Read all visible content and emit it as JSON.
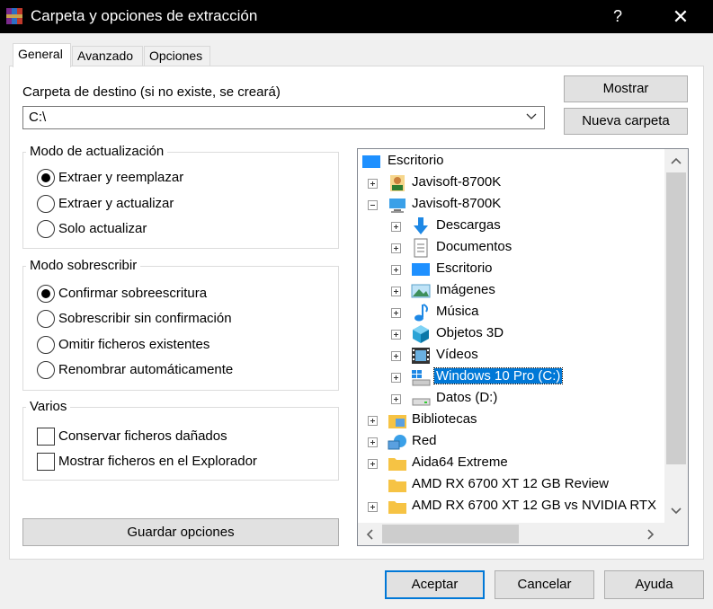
{
  "window": {
    "title": "Carpeta y opciones de extracción",
    "help_glyph": "?",
    "close_glyph": "✕"
  },
  "tabs": [
    {
      "label": "General",
      "active": true
    },
    {
      "label": "Avanzado",
      "active": false
    },
    {
      "label": "Opciones",
      "active": false
    }
  ],
  "destination": {
    "label": "Carpeta de destino (si no existe, se creará)",
    "value": "C:\\"
  },
  "buttons": {
    "show": "Mostrar",
    "new_folder": "Nueva carpeta",
    "save_options": "Guardar opciones",
    "accept": "Aceptar",
    "cancel": "Cancelar",
    "help": "Ayuda"
  },
  "update_mode": {
    "title": "Modo de actualización",
    "options": [
      {
        "label": "Extraer y reemplazar",
        "checked": true
      },
      {
        "label": "Extraer y actualizar",
        "checked": false
      },
      {
        "label": "Solo actualizar",
        "checked": false
      }
    ]
  },
  "overwrite_mode": {
    "title": "Modo sobrescribir",
    "options": [
      {
        "label": "Confirmar sobreescritura",
        "checked": true
      },
      {
        "label": "Sobrescribir sin confirmación",
        "checked": false
      },
      {
        "label": "Omitir ficheros existentes",
        "checked": false
      },
      {
        "label": "Renombrar automáticamente",
        "checked": false
      }
    ]
  },
  "misc": {
    "title": "Varios",
    "options": [
      {
        "label": "Conservar ficheros dañados",
        "checked": false
      },
      {
        "label": "Mostrar ficheros en el Explorador",
        "checked": false
      }
    ]
  },
  "tree": {
    "items": [
      {
        "label": "Escritorio",
        "icon": "desktop-icon",
        "selected": false
      },
      {
        "label": "Javisoft-8700K",
        "icon": "user-icon",
        "selected": false
      },
      {
        "label": "Javisoft-8700K",
        "icon": "computer-icon",
        "selected": false
      },
      {
        "label": "Descargas",
        "icon": "downloads-icon",
        "selected": false
      },
      {
        "label": "Documentos",
        "icon": "documents-icon",
        "selected": false
      },
      {
        "label": "Escritorio",
        "icon": "desktop-icon",
        "selected": false
      },
      {
        "label": "Imágenes",
        "icon": "pictures-icon",
        "selected": false
      },
      {
        "label": "Música",
        "icon": "music-icon",
        "selected": false
      },
      {
        "label": "Objetos 3D",
        "icon": "3d-objects-icon",
        "selected": false
      },
      {
        "label": "Vídeos",
        "icon": "videos-icon",
        "selected": false
      },
      {
        "label": "Windows 10 Pro (C:)",
        "icon": "windows-drive-icon",
        "selected": true
      },
      {
        "label": "Datos (D:)",
        "icon": "drive-icon",
        "selected": false
      },
      {
        "label": "Bibliotecas",
        "icon": "libraries-icon",
        "selected": false
      },
      {
        "label": "Red",
        "icon": "network-icon",
        "selected": false
      },
      {
        "label": "Aida64 Extreme",
        "icon": "folder-icon",
        "selected": false
      },
      {
        "label": "AMD RX 6700 XT 12 GB Review",
        "icon": "folder-icon",
        "selected": false
      },
      {
        "label": "AMD RX 6700 XT 12 GB vs NVIDIA RTX",
        "icon": "folder-icon",
        "selected": false
      }
    ]
  },
  "colors": {
    "selection": "#0078d7",
    "titlebar": "#000000",
    "folder": "#f6c344"
  }
}
